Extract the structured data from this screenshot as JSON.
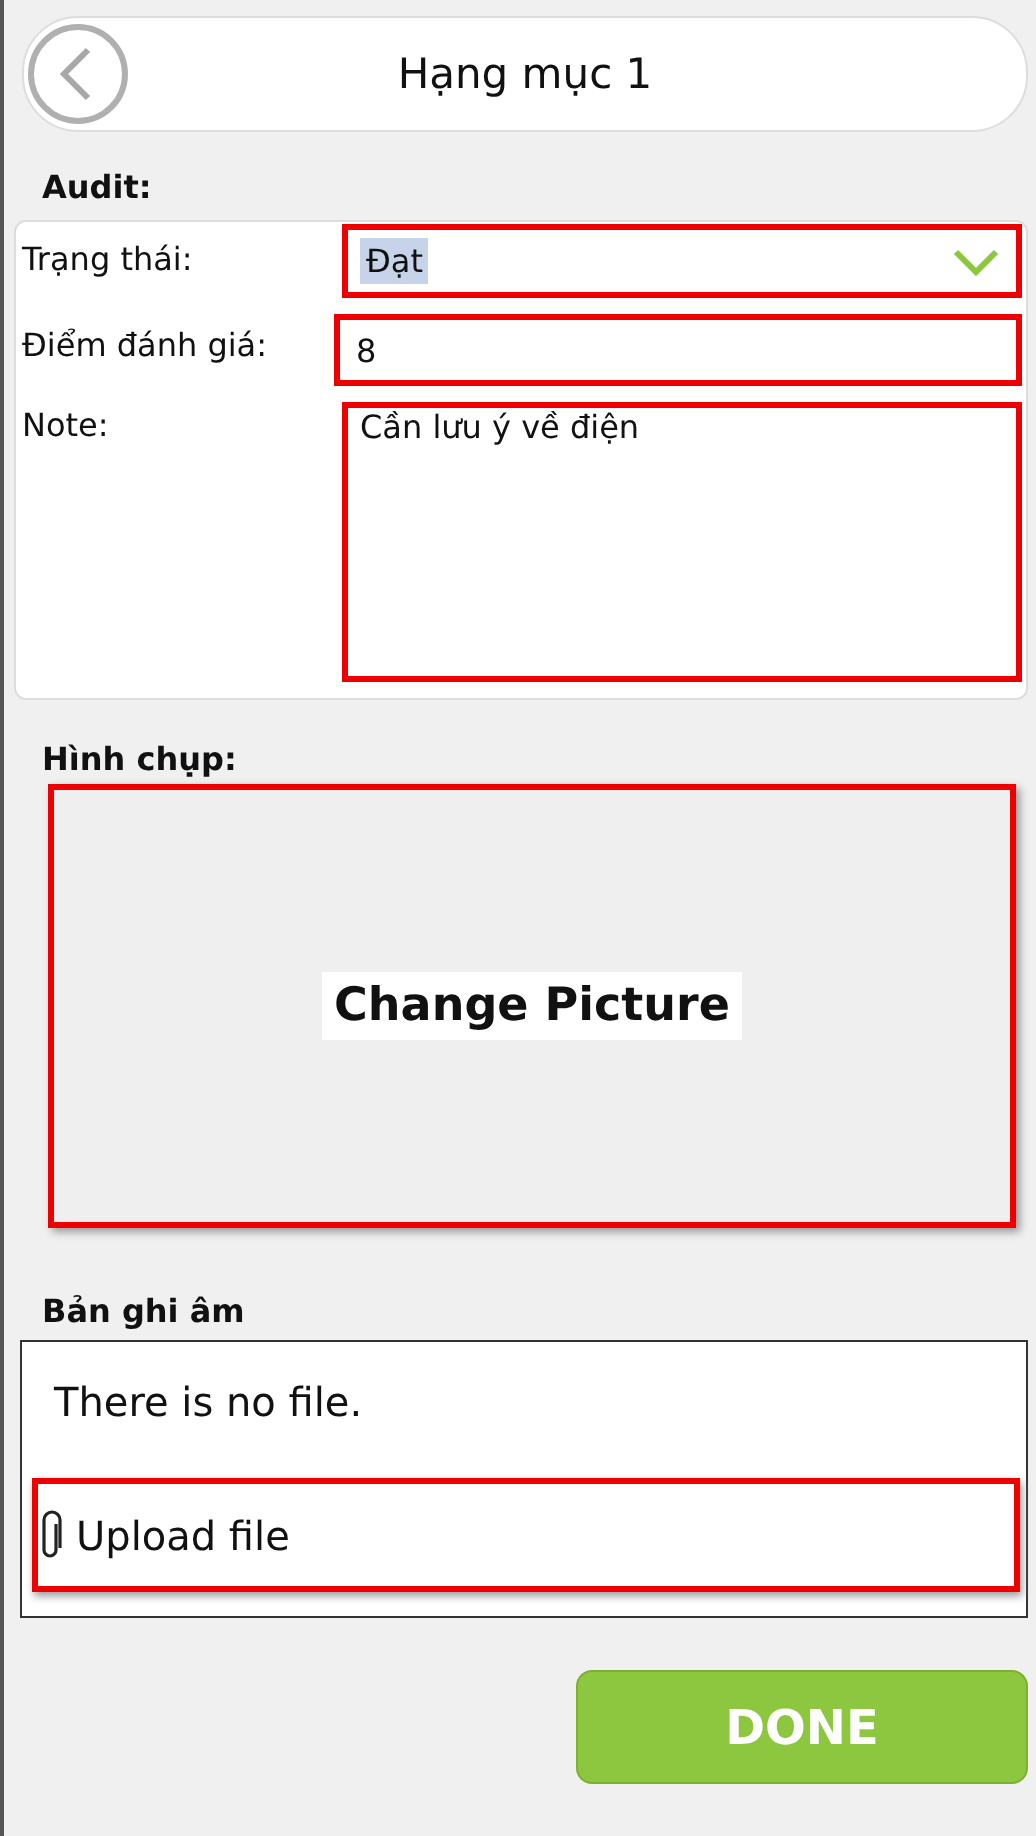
{
  "header": {
    "title": "Hạng mục 1"
  },
  "audit": {
    "heading": "Audit:",
    "fields": [
      {
        "kind": "dropdown",
        "label": "Trạng thái:",
        "value": "Đạt",
        "text_selected": true
      },
      {
        "kind": "text",
        "label": "Điểm đánh giá:",
        "value": "8"
      },
      {
        "kind": "textarea",
        "label": "Note:",
        "value": "Cần lưu ý về điện"
      }
    ]
  },
  "photo": {
    "heading": "Hình chụp:",
    "button": "Change Picture"
  },
  "recording": {
    "heading": "Bản ghi âm",
    "empty_text": "There is no file.",
    "upload": "Upload file"
  },
  "done_button": "DONE"
}
